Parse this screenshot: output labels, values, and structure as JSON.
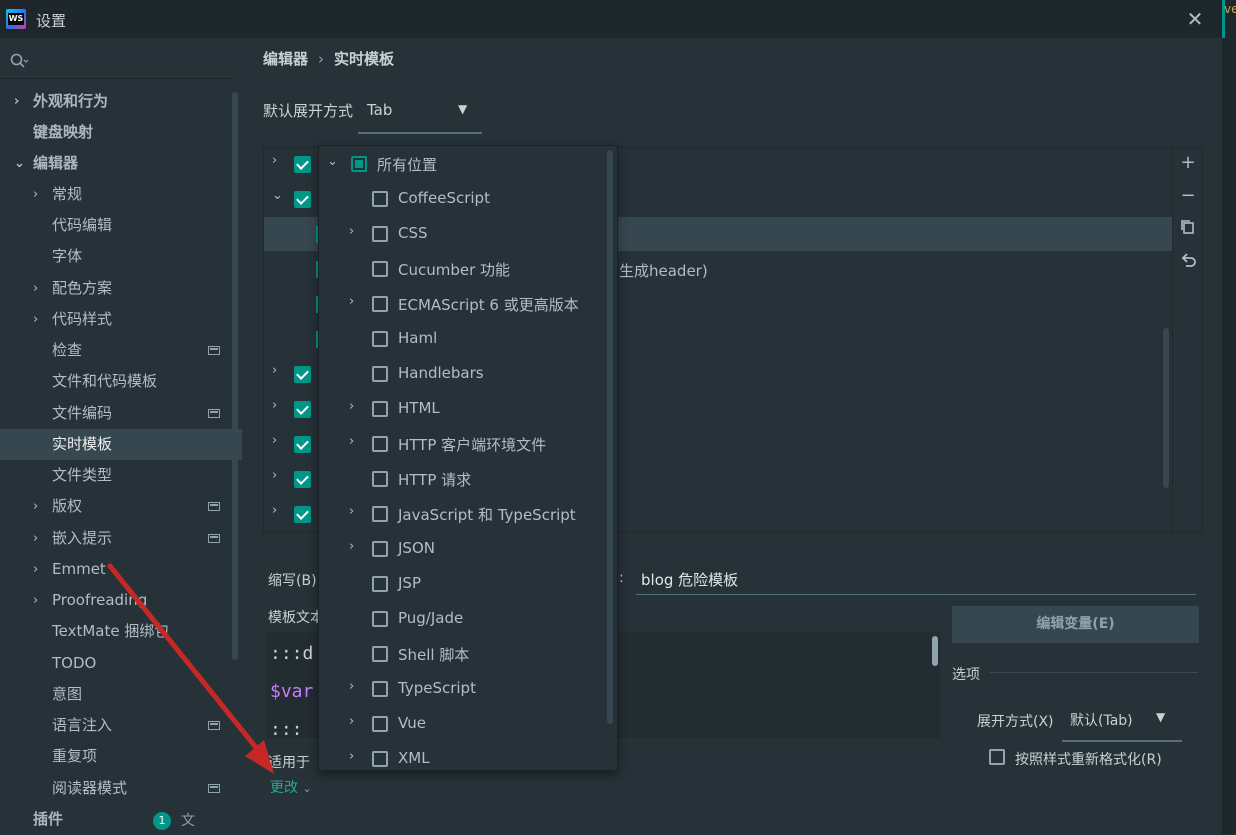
{
  "window": {
    "title": "设置",
    "app_icon": "WS",
    "right_tab": "ve"
  },
  "sidebar": {
    "items": [
      {
        "label": "外观和行为",
        "chevron": "›",
        "bold": true
      },
      {
        "label": "键盘映射",
        "chevron": "",
        "bold": true
      },
      {
        "label": "编辑器",
        "chevron": "⌄",
        "bold": true
      },
      {
        "label": "常规",
        "chevron": "›"
      },
      {
        "label": "代码编辑",
        "chevron": ""
      },
      {
        "label": "字体",
        "chevron": ""
      },
      {
        "label": "配色方案",
        "chevron": "›"
      },
      {
        "label": "代码样式",
        "chevron": "›"
      },
      {
        "label": "检查",
        "chevron": "",
        "mark": true
      },
      {
        "label": "文件和代码模板",
        "chevron": ""
      },
      {
        "label": "文件编码",
        "chevron": "",
        "mark": true
      },
      {
        "label": "实时模板",
        "chevron": "",
        "selected": true
      },
      {
        "label": "文件类型",
        "chevron": ""
      },
      {
        "label": "版权",
        "chevron": "›",
        "mark": true
      },
      {
        "label": "嵌入提示",
        "chevron": "›",
        "mark": true
      },
      {
        "label": "Emmet",
        "chevron": "›"
      },
      {
        "label": "Proofreading",
        "chevron": "›"
      },
      {
        "label": "TextMate 捆绑包",
        "chevron": ""
      },
      {
        "label": "TODO",
        "chevron": ""
      },
      {
        "label": "意图",
        "chevron": ""
      },
      {
        "label": "语言注入",
        "chevron": "",
        "mark": true
      },
      {
        "label": "重复项",
        "chevron": ""
      },
      {
        "label": "阅读器模式",
        "chevron": "",
        "mark": true
      },
      {
        "label": "插件",
        "chevron": "",
        "bold": true
      }
    ],
    "plugins_badge": "1",
    "plugins_badge_extra": "文"
  },
  "breadcrumb": {
    "parent": "编辑器",
    "separator": "›",
    "current": "实时模板"
  },
  "default_expand": {
    "label": "默认展开方式",
    "value": "Tab"
  },
  "tree": {
    "partial_text": "生成header)"
  },
  "toolbar_icons": [
    "plus-icon",
    "minus-icon",
    "copy-icon",
    "undo-icon"
  ],
  "form": {
    "abbreviation_label": "缩写(B)",
    "description_colon": ":",
    "description_value": "blog 危险模板",
    "template_text_label": "模板文本",
    "code_lines": [
      ":::d",
      "$var",
      ":::"
    ],
    "edit_vars_button": "编辑变量(E)",
    "options_title": "选项",
    "expand_with_label": "展开方式(X)",
    "expand_with_value": "默认(Tab)",
    "reformat_label": "按照样式重新格式化(R)",
    "applicable_label": "适用于",
    "change_link": "更改"
  },
  "popup": {
    "all_label": "所有位置",
    "items": [
      {
        "label": "CoffeeScript",
        "chevron": false
      },
      {
        "label": "CSS",
        "chevron": true
      },
      {
        "label": "Cucumber 功能",
        "chevron": false
      },
      {
        "label": "ECMAScript 6 或更高版本",
        "chevron": true
      },
      {
        "label": "Haml",
        "chevron": false
      },
      {
        "label": "Handlebars",
        "chevron": false
      },
      {
        "label": "HTML",
        "chevron": true
      },
      {
        "label": "HTTP 客户端环境文件",
        "chevron": true
      },
      {
        "label": "HTTP 请求",
        "chevron": false
      },
      {
        "label": "JavaScript 和 TypeScript",
        "chevron": true
      },
      {
        "label": "JSON",
        "chevron": true
      },
      {
        "label": "JSP",
        "chevron": false
      },
      {
        "label": "Pug/Jade",
        "chevron": false
      },
      {
        "label": "Shell 脚本",
        "chevron": false
      },
      {
        "label": "TypeScript",
        "chevron": true
      },
      {
        "label": "Vue",
        "chevron": true
      },
      {
        "label": "XML",
        "chevron": true
      }
    ]
  },
  "colors": {
    "accent": "#009688",
    "background": "#263238",
    "selection": "#37474f",
    "annotation_arrow": "#c62828"
  }
}
